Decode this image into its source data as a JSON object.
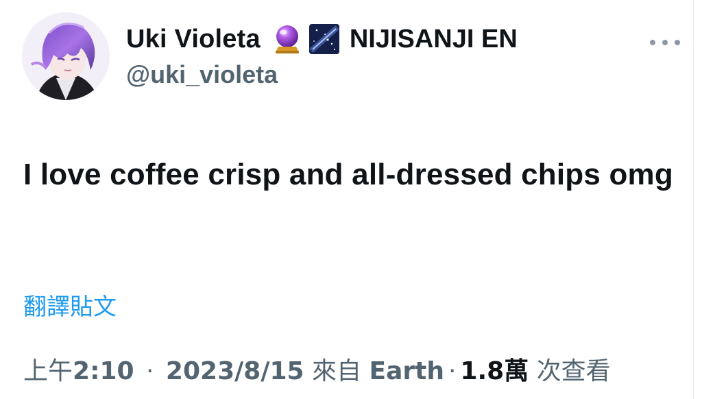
{
  "author": {
    "display_name": "Uki Violeta",
    "org_name": "NIJISANJI EN",
    "handle": "@uki_violeta",
    "emojis": [
      "crystal-ball-icon",
      "milky-way-icon"
    ]
  },
  "tweet": {
    "text": "I love coffee crisp and all-dressed chips omg",
    "translate_label": "翻譯貼文"
  },
  "meta": {
    "time_prefix": "上午",
    "time": "2:10",
    "separator": "·",
    "date": "2023/8/15",
    "source_prefix": "來自",
    "source": "Earth",
    "views_count": "1.8萬",
    "views_label": "次查看"
  },
  "colors": {
    "text_primary": "#0f1419",
    "text_secondary": "#536471",
    "link": "#1d9bf0",
    "more_dots": "#8b98a5"
  }
}
